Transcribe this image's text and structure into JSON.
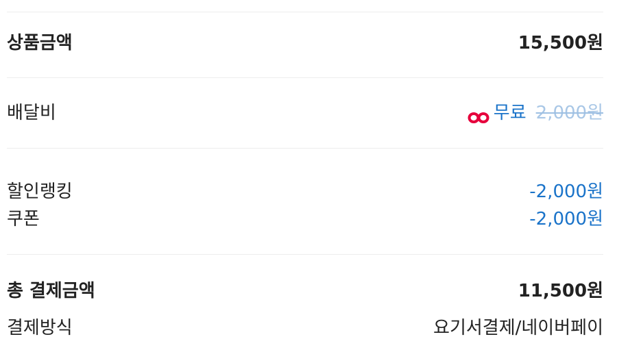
{
  "product": {
    "label": "상품금액",
    "value": "15,500원"
  },
  "delivery": {
    "label": "배달비",
    "badge_icon": "infinity-membership-icon",
    "free_label": "무료",
    "original_fee": "2,000원"
  },
  "discounts": [
    {
      "label": "할인랭킹",
      "value": "-2,000원"
    },
    {
      "label": "쿠폰",
      "value": "-2,000원"
    }
  ],
  "total": {
    "label": "총 결제금액",
    "value": "11,500원"
  },
  "payment": {
    "label": "결제방식",
    "value": "요기서결제/네이버페이"
  },
  "colors": {
    "text": "#222222",
    "discount_blue": "#1a73c9",
    "badge_red": "#e6003c",
    "divider": "#ededed"
  }
}
